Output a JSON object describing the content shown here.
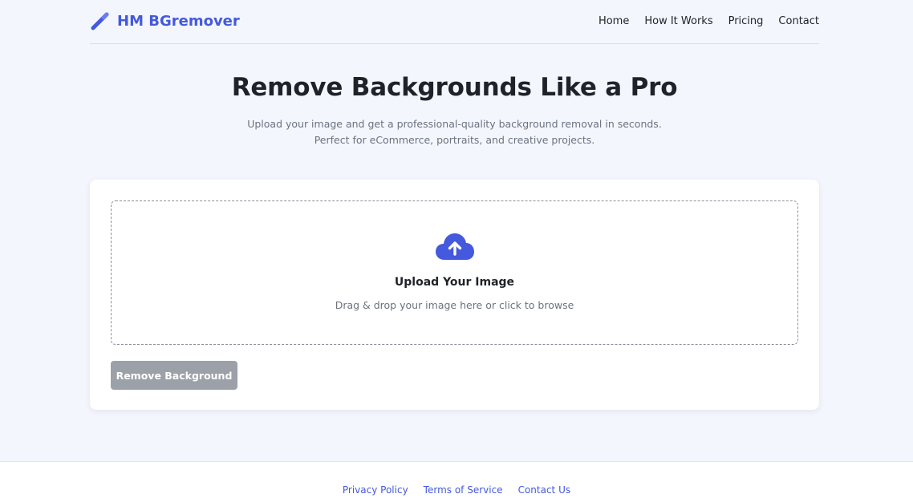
{
  "brand": {
    "name": "HM BGremover",
    "icon": "magic-wand-icon",
    "accent_color": "#4459dd"
  },
  "nav": {
    "items": [
      "Home",
      "How It Works",
      "Pricing",
      "Contact"
    ]
  },
  "hero": {
    "title": "Remove Backgrounds Like a Pro",
    "subtitle": "Upload your image and get a professional-quality background removal in seconds. Perfect for eCommerce, portraits, and creative projects."
  },
  "upload": {
    "icon": "cloud-upload-icon",
    "title": "Upload Your Image",
    "hint": "Drag & drop your image here or click to browse"
  },
  "actions": {
    "remove_label": "Remove Background",
    "remove_disabled": true
  },
  "footer": {
    "links": [
      "Privacy Policy",
      "Terms of Service",
      "Contact Us"
    ]
  }
}
